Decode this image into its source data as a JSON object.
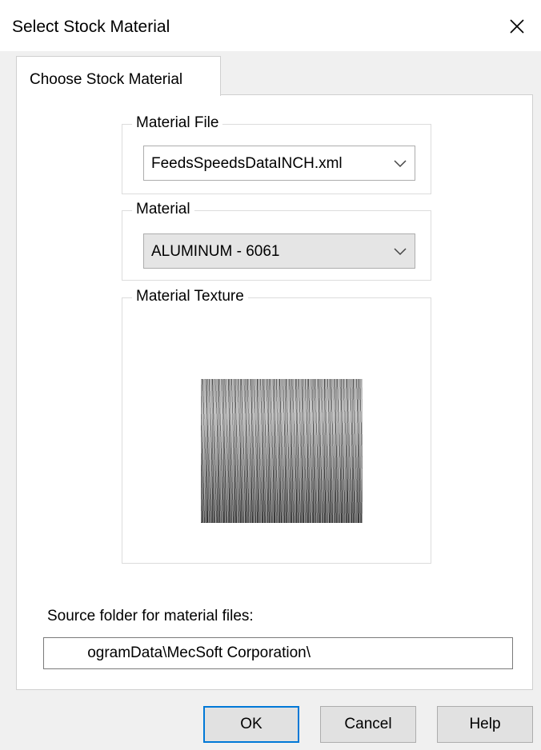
{
  "window": {
    "title": "Select Stock Material",
    "close_icon": "close-icon"
  },
  "tabs": [
    {
      "label": "Choose Stock Material",
      "active": true
    }
  ],
  "material_file": {
    "group_title": "Material File",
    "selected": "FeedsSpeedsDataINCH.xml"
  },
  "material": {
    "group_title": "Material",
    "selected": "ALUMINUM - 6061"
  },
  "material_texture": {
    "group_title": "Material Texture",
    "preview": "brushed-metal-texture"
  },
  "source_folder": {
    "label": "Source folder for material files:",
    "value": "ogramData\\MecSoft Corporation\\"
  },
  "buttons": {
    "ok": "OK",
    "cancel": "Cancel",
    "help": "Help"
  },
  "colors": {
    "dialog_bg": "#f0f0f0",
    "default_button_border": "#0078d7"
  }
}
